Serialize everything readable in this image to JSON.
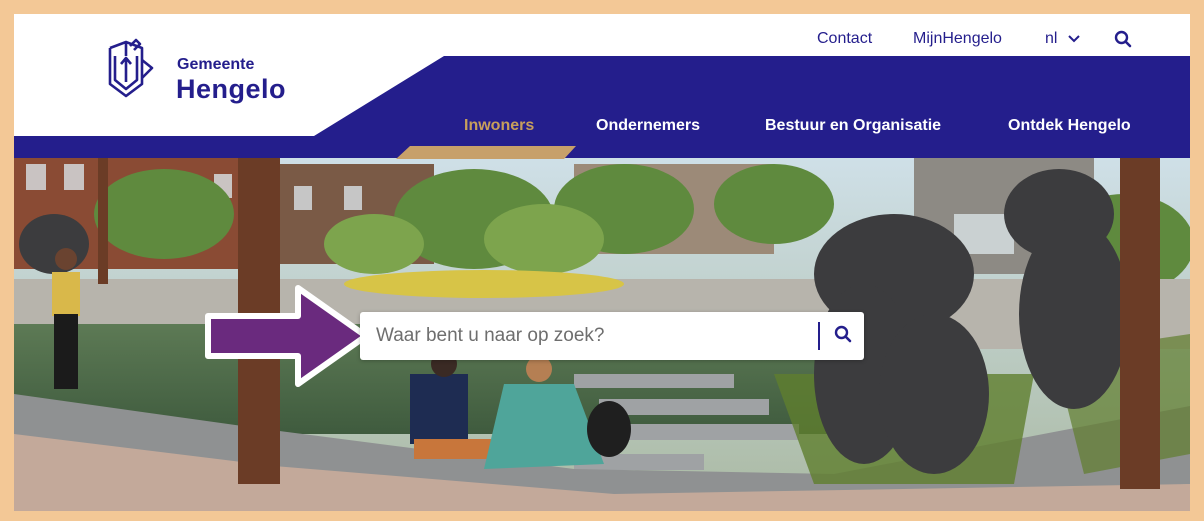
{
  "header": {
    "logo": {
      "line1": "Gemeente",
      "line2": "Hengelo",
      "icon": "hengelo-crest-icon"
    },
    "utility_nav": [
      {
        "label": "Contact"
      },
      {
        "label": "MijnHengelo"
      }
    ],
    "language": {
      "value": "nl",
      "icon": "chevron-down-icon"
    },
    "search_icon": "search-icon",
    "main_nav": [
      {
        "label": "Inwoners",
        "active": true
      },
      {
        "label": "Ondernemers",
        "active": false
      },
      {
        "label": "Bestuur en Organisatie",
        "active": false
      },
      {
        "label": "Ontdek Hengelo",
        "active": false
      }
    ]
  },
  "hero": {
    "search": {
      "placeholder": "Waar bent u naar op zoek?",
      "value": "",
      "icon": "search-icon"
    },
    "annotation": "arrow-pointing-to-search"
  },
  "colors": {
    "brand_blue": "#241e8c",
    "active_nav": "#c79f5c",
    "frame": "#f3c896",
    "arrow_purple": "#6a2a7e"
  }
}
